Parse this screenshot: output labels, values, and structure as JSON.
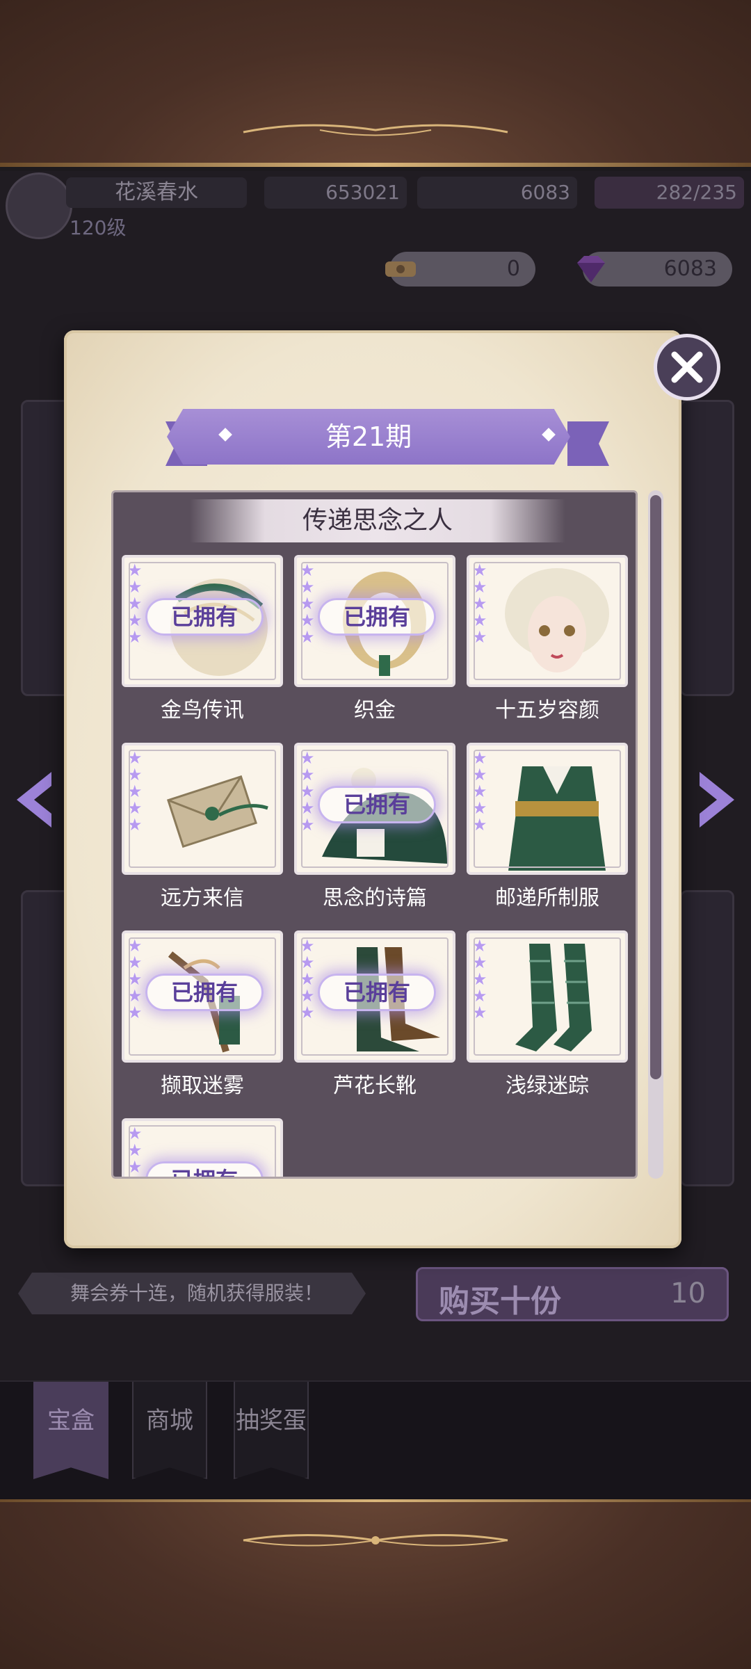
{
  "hud": {
    "player_name": "花溪春水",
    "player_level": "120级",
    "coins": "653021",
    "gems": "6083",
    "stamina": "282/235"
  },
  "resources": {
    "tickets": "0",
    "gems": "6083"
  },
  "modal": {
    "period_title": "第21期",
    "set_title": "传递思念之人",
    "owned_label": "已拥有",
    "items": [
      {
        "name": "金鸟传讯",
        "owned": true,
        "stars": 5
      },
      {
        "name": "织金",
        "owned": true,
        "stars": 5
      },
      {
        "name": "十五岁容颜",
        "owned": false,
        "stars": 5
      },
      {
        "name": "远方来信",
        "owned": false,
        "stars": 5
      },
      {
        "name": "思念的诗篇",
        "owned": true,
        "stars": 5
      },
      {
        "name": "邮递所制服",
        "owned": false,
        "stars": 5
      },
      {
        "name": "撷取迷雾",
        "owned": true,
        "stars": 5
      },
      {
        "name": "芦花长靴",
        "owned": true,
        "stars": 5
      },
      {
        "name": "浅绿迷踪",
        "owned": false,
        "stars": 5
      },
      {
        "name": "",
        "owned": true,
        "stars": 5
      }
    ]
  },
  "bottom": {
    "tip": "舞会券十连，随机获得服装！",
    "buy_ten_label": "购买十份",
    "buy_ten_cost": "10"
  },
  "tabs": [
    {
      "label": "宝盒",
      "active": true
    },
    {
      "label": "商城",
      "active": false
    },
    {
      "label": "抽奖蛋",
      "active": false
    }
  ],
  "colors": {
    "accent_purple": "#8d74c8",
    "panel_bg": "#5a4f5c",
    "parchment": "#efe5cf"
  }
}
